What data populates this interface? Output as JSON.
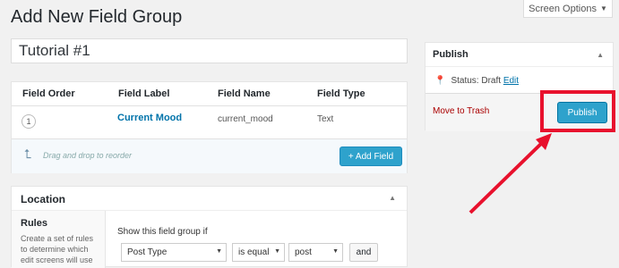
{
  "page_title": "Add New Field Group",
  "screen_options": {
    "label": "Screen Options",
    "icon": "▼"
  },
  "title_input": {
    "value": "Tutorial #1"
  },
  "fields_table": {
    "headers": [
      "Field Order",
      "Field Label",
      "Field Name",
      "Field Type"
    ],
    "rows": [
      {
        "order": "1",
        "label": "Current Mood",
        "name": "current_mood",
        "type": "Text"
      }
    ],
    "drag_hint": "Drag and drop to reorder",
    "add_button": "+ Add Field"
  },
  "location": {
    "title": "Location",
    "rules_title": "Rules",
    "rules_desc": "Create a set of rules to determine which edit screens will use",
    "show_if": "Show this field group if",
    "param_select": "Post Type",
    "operator_select": "is equal",
    "value_select": "post",
    "and_button": "and"
  },
  "publish": {
    "title": "Publish",
    "status_label": "Status: Draft",
    "status_edit": "Edit",
    "trash_link": "Move to Trash",
    "publish_button": "Publish"
  },
  "colors": {
    "accent": "#2ea2cc",
    "highlight": "#e8112d",
    "trash": "#aa0000"
  }
}
